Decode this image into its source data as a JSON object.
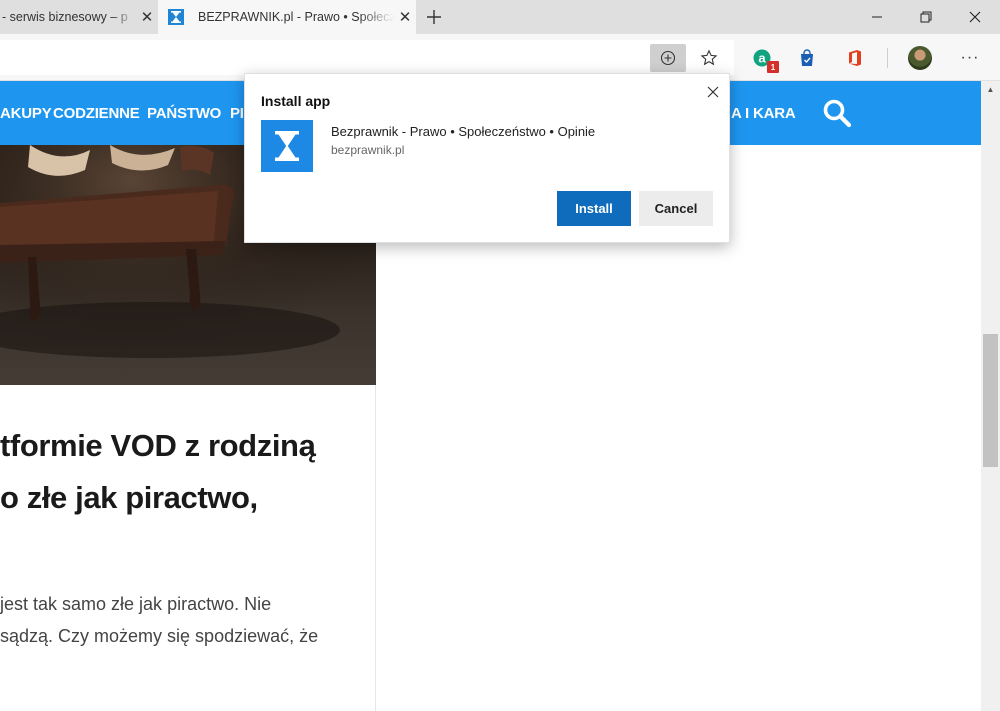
{
  "tabs": [
    {
      "title": "- serwis biznesowy – p",
      "active": false
    },
    {
      "title": "BEZPRAWNIK.pl - Prawo • Społeczeństwo • Opinie",
      "active": true
    }
  ],
  "window_controls": [
    "minimize",
    "restore",
    "close"
  ],
  "toolbar": {
    "icons": [
      "add-app-icon",
      "favorite-star-icon",
      "extension-a-icon",
      "shopping-bag-icon",
      "office-icon",
      "profile-avatar",
      "more-icon"
    ],
    "extension_badge": "1",
    "more_label": "···"
  },
  "site_nav": {
    "items": [
      "AKUPY",
      "CODZIENNE",
      "PAŃSTWO",
      "PI",
      "A I KARA"
    ],
    "accent": "#1e96f0"
  },
  "article": {
    "headline_lines": [
      "tformie VOD z rodziną",
      "o złe jak piractwo,"
    ],
    "paragraph_lines": [
      "jest tak samo złe jak piractwo. Nie",
      "sądzą. Czy możemy się spodziewać, że"
    ]
  },
  "install_popup": {
    "title": "Install app",
    "app_name": "Bezprawnik - Prawo • Społeczeństwo • Opinie",
    "app_url": "bezprawnik.pl",
    "install_label": "Install",
    "cancel_label": "Cancel",
    "accent": "#0f6cbd"
  }
}
